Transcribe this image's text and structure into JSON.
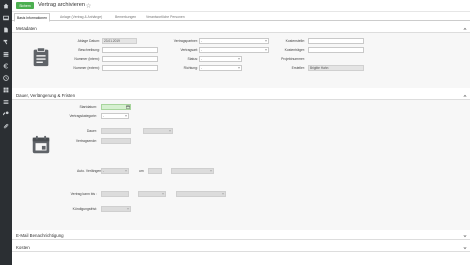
{
  "toolbar": {
    "save_label": "Sichern",
    "title": "Vertrag archivieren"
  },
  "tabs": [
    {
      "label": "Basis Informationen",
      "active": true
    },
    {
      "label": "Anlage (Vertrag & Anhänge)",
      "active": false
    },
    {
      "label": "Bemerkungen",
      "active": false
    },
    {
      "label": "Verantwortliche Personen",
      "active": false
    }
  ],
  "sections": {
    "metadaten": "Metadaten",
    "dauer": "Dauer, Verlängerung & Fristen",
    "email": "E-Mail Benachrichtigung",
    "kosten": "Kosten"
  },
  "metadaten": {
    "ablage_datum_label": "Ablage Datum:",
    "ablage_datum_value": "23.01.2019",
    "beschreibung_label": "Beschreibung:",
    "nummer_intern_label": "Nummer (intern):",
    "nummer_extern_label": "Nummer (extern):",
    "vertragspartner_label": "Vertragspartner:",
    "vertragspartner_value": "-",
    "vertragsart_label": "Vertragsart:",
    "vertragsart_value": "-",
    "status_label": "Status:",
    "status_value": "-",
    "richtung_label": "Richtung:",
    "richtung_value": "-",
    "kostenstelle_label": "Kostenstelle:",
    "kostentraeger_label": "Kostenträger:",
    "projektnummer_label": "Projektnummer:",
    "ersteller_label": "Ersteller:",
    "ersteller_value": "Brigitte Hahn"
  },
  "dauer": {
    "startdatum_label": "Startdatum:",
    "vertragskategorie_label": "Vertragskategorie:",
    "vertragskategorie_value": "-",
    "dauer_label": "Dauer:",
    "vertragsende_label": "Vertragsende:",
    "auto_verl_label": "Auto. Verlängerung:",
    "auto_verl_value": "-",
    "um_label": "um",
    "vertrag_kuendbar_label": "Vertrag kann bis :",
    "kuendigungsfrist_label": "Kündigungsfrist:"
  },
  "colors": {
    "sidebar": "#2b2f33",
    "accent_green": "#4caf50",
    "start_field": "#d6f0d0"
  },
  "icons": {
    "sidebar": [
      "home-icon",
      "inbox-icon",
      "file-icon",
      "hammer-icon",
      "stack-icon",
      "euro-icon",
      "clock-icon",
      "grid-icon",
      "list-icon",
      "wrench-icon",
      "link-icon"
    ]
  }
}
